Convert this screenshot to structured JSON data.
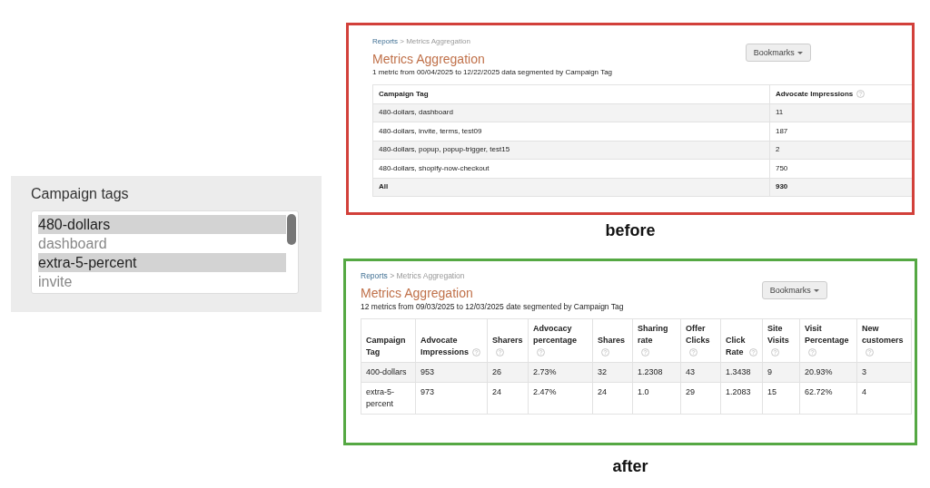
{
  "tag_picker": {
    "label": "Campaign tags",
    "options": [
      {
        "text": "480-dollars",
        "selected": true
      },
      {
        "text": "dashboard",
        "selected": false
      },
      {
        "text": "extra-5-percent",
        "selected": true
      },
      {
        "text": "invite",
        "selected": false
      }
    ]
  },
  "panels": [
    {
      "color": "#d2403a",
      "caption": "before",
      "breadcrumb": {
        "link": "Reports",
        "separator": ">",
        "current": "Metrics Aggregation"
      },
      "title": "Metrics Aggregation",
      "bookmarks": "Bookmarks",
      "subtitle": "1 metric from 00/04/2025 to 12/22/2025 data segmented by Campaign Tag",
      "columns": [
        {
          "label": "Campaign Tag",
          "help": false
        },
        {
          "label": "Advocate Impressions",
          "help": true
        }
      ],
      "rows": [
        {
          "kind": "data",
          "cells": [
            "480-dollars, dashboard",
            "11"
          ]
        },
        {
          "kind": "data",
          "cells": [
            "480-dollars, invite, terms, test09",
            "187"
          ]
        },
        {
          "kind": "data",
          "cells": [
            "480-dollars, popup, popup-trigger, test15",
            "2"
          ]
        },
        {
          "kind": "data",
          "cells": [
            "480-dollars, shopify-now-checkout",
            "750"
          ]
        },
        {
          "kind": "total",
          "cells": [
            "All",
            "930"
          ]
        }
      ]
    },
    {
      "color": "#55a843",
      "caption": "after",
      "breadcrumb": {
        "link": "Reports",
        "separator": ">",
        "current": "Metrics Aggregation"
      },
      "title": "Metrics Aggregation",
      "bookmarks": "Bookmarks",
      "subtitle": "12 metrics from 09/03/2025 to 12/03/2025 date segmented by Campaign Tag",
      "columns": [
        {
          "label": "Campaign Tag",
          "help": false
        },
        {
          "label": "Advocate Impressions",
          "help": true
        },
        {
          "label": "Sharers",
          "help": true
        },
        {
          "label": "Advocacy percentage",
          "help": true
        },
        {
          "label": "Shares",
          "help": true
        },
        {
          "label": "Sharing rate",
          "help": true
        },
        {
          "label": "Offer Clicks",
          "help": true
        },
        {
          "label": "Click Rate",
          "help": true
        },
        {
          "label": "Site Visits",
          "help": true
        },
        {
          "label": "Visit Percentage",
          "help": true
        },
        {
          "label": "New customers",
          "help": true
        }
      ],
      "rows": [
        {
          "kind": "data",
          "cells": [
            "400-dollars",
            "953",
            "26",
            "2.73%",
            "32",
            "1.2308",
            "43",
            "1.3438",
            "9",
            "20.93%",
            "3"
          ]
        },
        {
          "kind": "data",
          "cells": [
            "extra-5-percent",
            "973",
            "24",
            "2.47%",
            "24",
            "1.0",
            "29",
            "1.2083",
            "15",
            "62.72%",
            "4"
          ]
        }
      ]
    }
  ]
}
